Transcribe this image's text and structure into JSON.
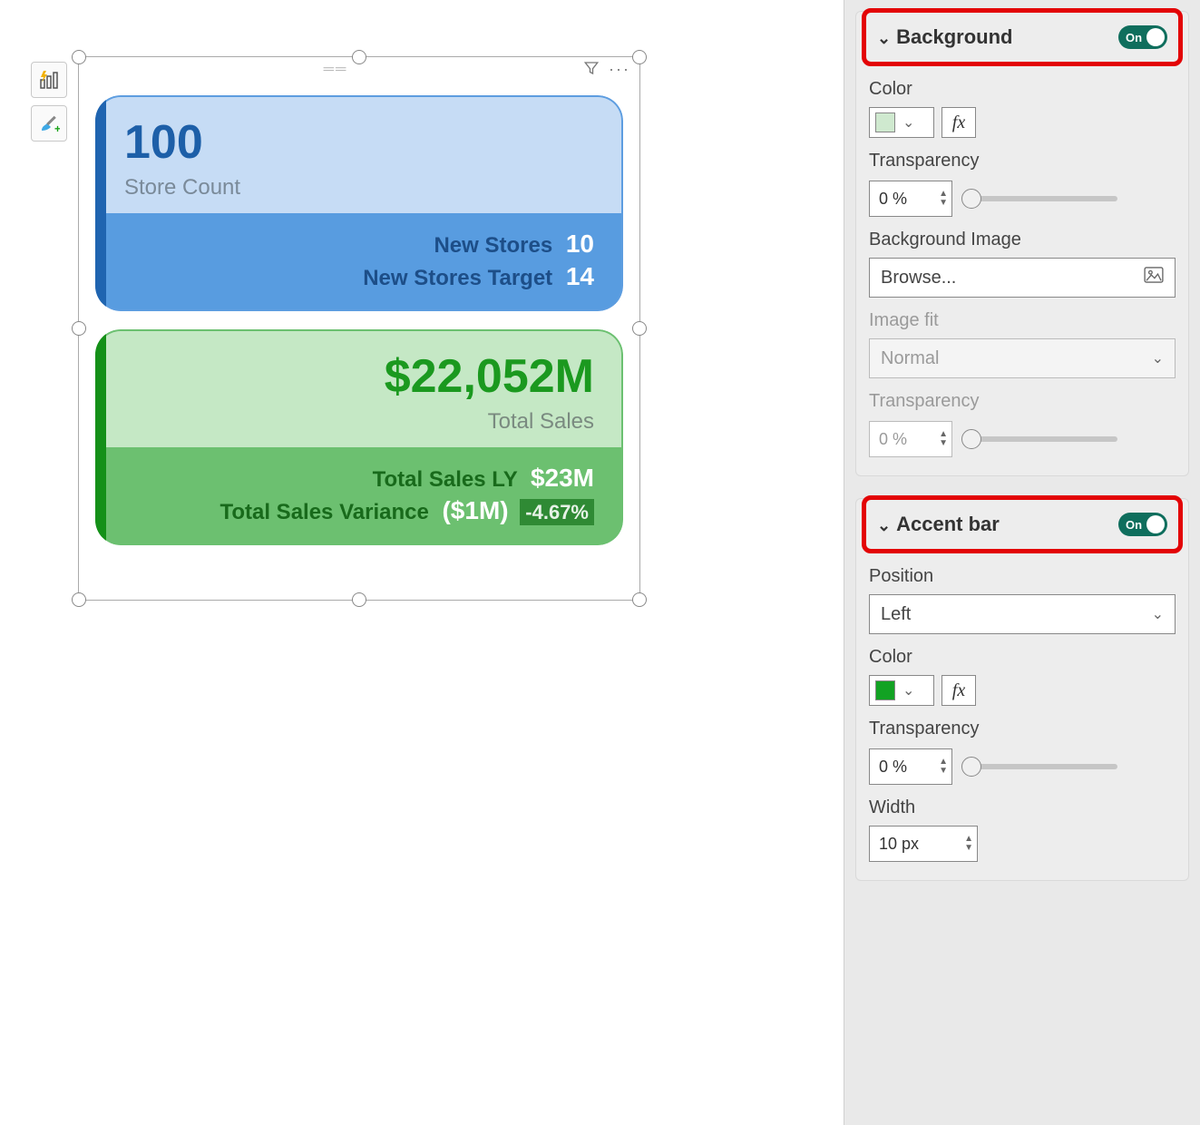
{
  "cards": {
    "blue": {
      "value": "100",
      "label": "Store Count",
      "line1_label": "New Stores",
      "line1_value": "10",
      "line2_label": "New Stores Target",
      "line2_value": "14"
    },
    "green": {
      "value": "$22,052M",
      "label": "Total Sales",
      "line1_label": "Total Sales LY",
      "line1_value": "$23M",
      "line2_label": "Total Sales Variance",
      "line2_value": "($1M)",
      "line2_pct": "-4.67%"
    }
  },
  "pane": {
    "background": {
      "title": "Background",
      "toggle": "On",
      "color_label": "Color",
      "color_swatch": "#cfe9cf",
      "fx": "fx",
      "transparency_label": "Transparency",
      "transparency_value": "0 %",
      "bg_image_label": "Background Image",
      "bg_image_value": "Browse...",
      "image_fit_label": "Image fit",
      "image_fit_value": "Normal",
      "img_transparency_label": "Transparency",
      "img_transparency_value": "0 %"
    },
    "accent": {
      "title": "Accent bar",
      "toggle": "On",
      "position_label": "Position",
      "position_value": "Left",
      "color_label": "Color",
      "color_swatch": "#12a223",
      "fx": "fx",
      "transparency_label": "Transparency",
      "transparency_value": "0 %",
      "width_label": "Width",
      "width_value": "10 px"
    }
  }
}
